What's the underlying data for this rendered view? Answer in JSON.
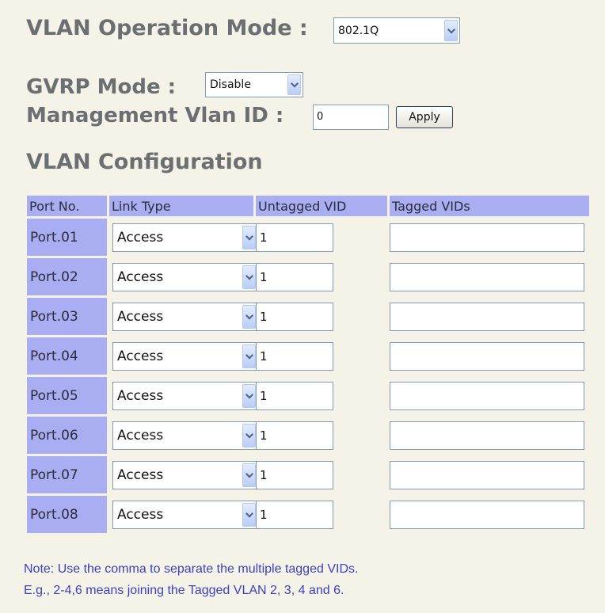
{
  "header": {
    "vlan_operation_mode_label": "VLAN Operation Mode :",
    "vlan_operation_mode_value": "802.1Q",
    "gvrp_mode_label": "GVRP Mode :",
    "gvrp_mode_value": "Disable",
    "management_vlan_label": "Management Vlan ID :",
    "management_vlan_value": "0",
    "apply_label": "Apply",
    "section_title": "VLAN Configuration"
  },
  "table": {
    "columns": [
      "Port No.",
      "Link Type",
      "Untagged VID",
      "Tagged VIDs"
    ],
    "rows": [
      {
        "port": "Port.01",
        "link_type": "Access",
        "untagged_vid": "1",
        "tagged_vids": ""
      },
      {
        "port": "Port.02",
        "link_type": "Access",
        "untagged_vid": "1",
        "tagged_vids": ""
      },
      {
        "port": "Port.03",
        "link_type": "Access",
        "untagged_vid": "1",
        "tagged_vids": ""
      },
      {
        "port": "Port.04",
        "link_type": "Access",
        "untagged_vid": "1",
        "tagged_vids": ""
      },
      {
        "port": "Port.05",
        "link_type": "Access",
        "untagged_vid": "1",
        "tagged_vids": ""
      },
      {
        "port": "Port.06",
        "link_type": "Access",
        "untagged_vid": "1",
        "tagged_vids": ""
      },
      {
        "port": "Port.07",
        "link_type": "Access",
        "untagged_vid": "1",
        "tagged_vids": ""
      },
      {
        "port": "Port.08",
        "link_type": "Access",
        "untagged_vid": "1",
        "tagged_vids": ""
      }
    ]
  },
  "note": {
    "line1": "Note: Use the comma to separate the multiple tagged VIDs.",
    "line2": "E.g., 2-4,6 means joining the Tagged VLAN 2, 3, 4 and 6."
  },
  "icons": {
    "dropdown_arrow": "chevron-down-icon"
  },
  "colors": {
    "background": "#f5f3e7",
    "heading_text": "#6b6f72",
    "table_header_bg": "#a9aef2",
    "note_text": "#3a40c8"
  }
}
